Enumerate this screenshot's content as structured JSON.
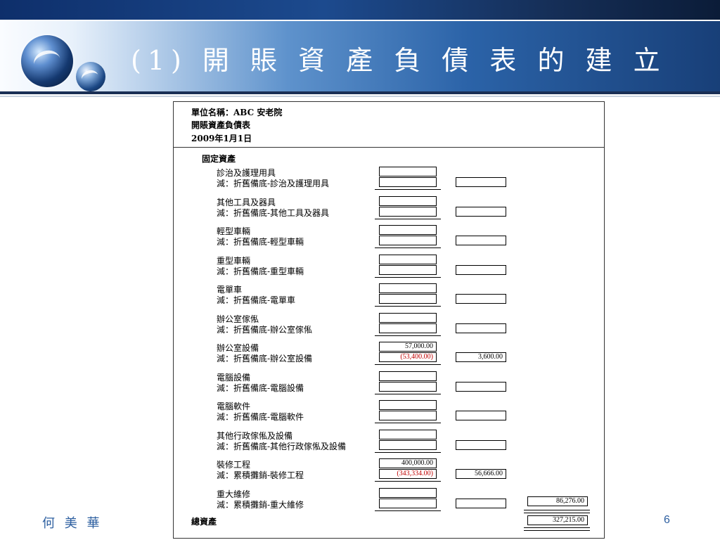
{
  "slide": {
    "title": "(1) 開 賬 資 產 負 債 表 的 建 立",
    "author": "何 美 華",
    "page_number": "6"
  },
  "sheet": {
    "unit_line": "單位名稱：ABC 安老院",
    "statement_name": "開賬資產負債表",
    "date": "2009年1月1日",
    "section_label": "固定資產",
    "items": [
      {
        "asset": "診治及護理用具",
        "less": "減：折舊備底-診治及護理用具",
        "cost": "",
        "deduction": "",
        "net": ""
      },
      {
        "asset": "其他工具及器具",
        "less": "減：折舊備底-其他工具及器具",
        "cost": "",
        "deduction": "",
        "net": ""
      },
      {
        "asset": "輕型車輛",
        "less": "減：折舊備底-輕型車輛",
        "cost": "",
        "deduction": "",
        "net": ""
      },
      {
        "asset": "重型車輛",
        "less": "減：折舊備底-重型車輛",
        "cost": "",
        "deduction": "",
        "net": ""
      },
      {
        "asset": "電單車",
        "less": "減：折舊備底-電單車",
        "cost": "",
        "deduction": "",
        "net": ""
      },
      {
        "asset": "辦公室傢俬",
        "less": "減：折舊備底-辦公室傢俬",
        "cost": "",
        "deduction": "",
        "net": ""
      },
      {
        "asset": "辦公室設備",
        "less": "減：折舊備底-辦公室設備",
        "cost": "57,000.00",
        "deduction": "(53,400.00)",
        "net": "3,600.00"
      },
      {
        "asset": "電腦設備",
        "less": "減：折舊備底-電腦設備",
        "cost": "",
        "deduction": "",
        "net": ""
      },
      {
        "asset": "電腦軟件",
        "less": "減：折舊備底-電腦軟件",
        "cost": "",
        "deduction": "",
        "net": ""
      },
      {
        "asset": "其他行政傢俬及設備",
        "less": "減：折舊備底-其他行政傢俬及設備",
        "cost": "",
        "deduction": "",
        "net": ""
      },
      {
        "asset": "裝修工程",
        "less": "減：累積攤銷-裝修工程",
        "cost": "400,000.00",
        "deduction": "(343,334.00)",
        "net": "56,666.00"
      },
      {
        "asset": "重大維修",
        "less": "減：累積攤銷-重大維修",
        "cost": "",
        "deduction": "",
        "net": ""
      }
    ],
    "fixed_assets_total": "86,276.00",
    "total_label": "總資產",
    "total_value": "327,215.00"
  },
  "colors": {
    "header_dark": "#0e2f6b",
    "header_mid": "#2b63a8",
    "deduction_red": "#c00000",
    "footer_blue": "#2d5fa0"
  }
}
